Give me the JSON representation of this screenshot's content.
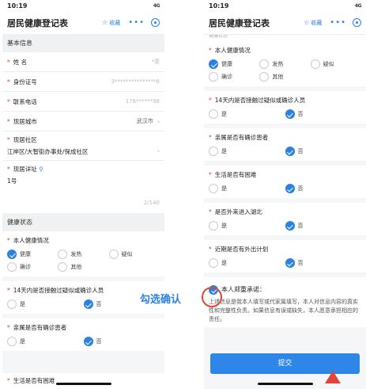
{
  "status": {
    "time": "10:19",
    "signal": "4G"
  },
  "nav": {
    "title": "居民健康登记表",
    "fav": "收藏",
    "more": "•••"
  },
  "left": {
    "basic_section": "基本信息",
    "fields": [
      {
        "label": "姓    名",
        "value": "*黍"
      },
      {
        "label": "身份证号",
        "value": "3***************6"
      },
      {
        "label": "联系电话",
        "value": "176******98"
      },
      {
        "label": "现居城市",
        "value": "武汉市"
      }
    ],
    "community_label": "现居社区",
    "community_value": "江岸区/大智街办事处/保成社区",
    "address_label": "现居详址",
    "address_value": "1号",
    "counter": "2/140",
    "health_section": "健康状态",
    "health_q": "本人健康情况",
    "health_opts": [
      "健康",
      "发热",
      "疑似",
      "确诊",
      "其他"
    ],
    "contact_q": "14天内是否接触过疑似或确诊人员",
    "family_q": "亲属是否有确诊患者",
    "yes": "是",
    "no": "否",
    "cut_q": "生活是否有困难"
  },
  "right": {
    "clip_text": "健康状态",
    "health_q": "本人健康情况",
    "health_opts": [
      "健康",
      "发热",
      "疑似",
      "确诊",
      "其他"
    ],
    "questions": [
      "14天内是否接触过疑似或确诊人员",
      "亲属是否有确诊患者",
      "生活是否有困难",
      "是否外来进入湖北",
      "近期是否有外出计划"
    ],
    "yes": "是",
    "no": "否",
    "promise_title": "本人郑重承诺：",
    "promise_text": "上述信息是我本人填写或代家属填写，本人对信息内容的真实性和完整性负责。如果信息有误或缺失，本人愿意承担相应的责任。",
    "submit": "提交"
  },
  "annotation": {
    "text": "勾选确认",
    "color": "#e0453a",
    "text_color": "#2a82e4"
  },
  "colors": {
    "accent": "#2a82e4",
    "required": "#e0453a"
  }
}
